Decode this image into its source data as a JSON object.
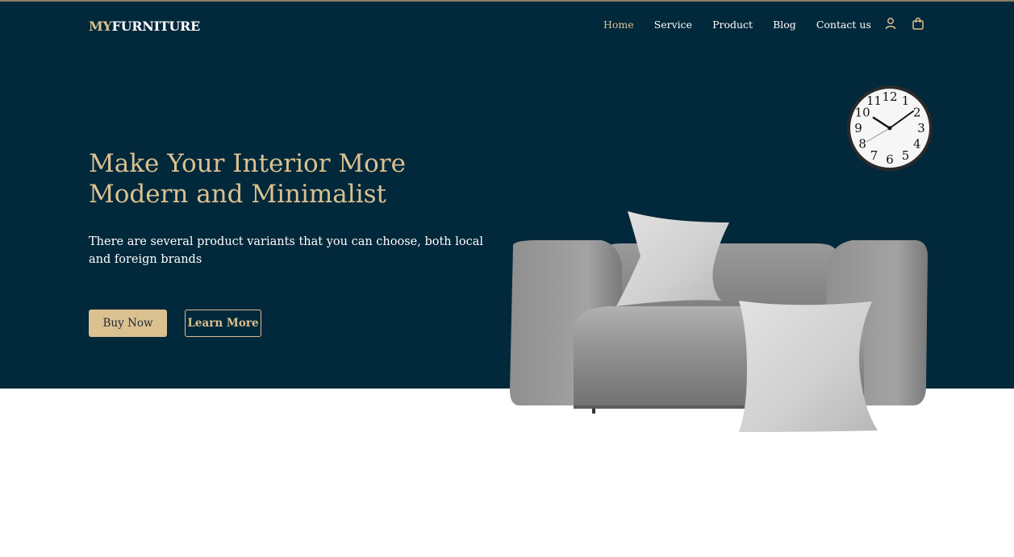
{
  "brand": {
    "prefix": "MY",
    "name": "FURNITURE",
    "accent_color": "#dbc190",
    "bg_color": "#02283b"
  },
  "nav": {
    "items": [
      {
        "label": "Home",
        "active": true
      },
      {
        "label": "Service",
        "active": false
      },
      {
        "label": "Product",
        "active": false
      },
      {
        "label": "Blog",
        "active": false
      },
      {
        "label": "Contact us",
        "active": false
      }
    ],
    "icons": [
      "user-icon",
      "shopping-bag-icon"
    ]
  },
  "hero": {
    "headline": "Make Your Interior More Modern and Minimalist",
    "subtext": "There are several product variants that you can choose, both local and foreign brands",
    "buy_label": "Buy Now",
    "learn_label": "Learn More"
  },
  "clock": {
    "numerals": [
      "12",
      "1",
      "2",
      "3",
      "4",
      "5",
      "6",
      "7",
      "8",
      "9",
      "10",
      "11"
    ]
  }
}
